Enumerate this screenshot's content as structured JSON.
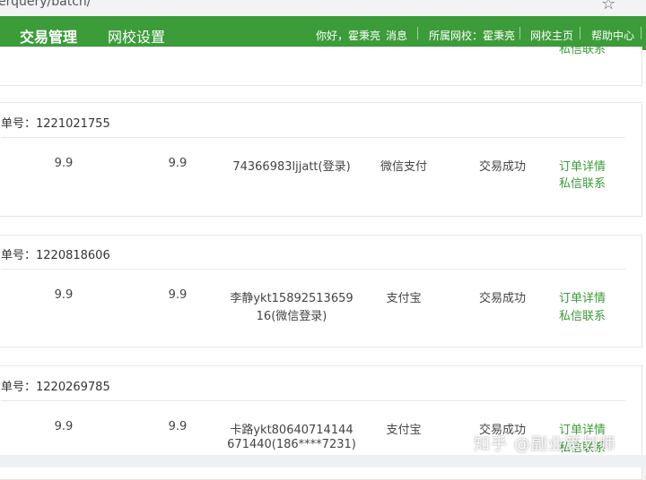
{
  "browser": {
    "url": "erquery/batch/"
  },
  "nav": {
    "tabs": [
      "交易管理",
      "网校设置"
    ],
    "greeting": "你好，霍秉亮",
    "messages": "消息",
    "school": "所属网校：霍秉亮",
    "home": "网校主页",
    "help": "帮助中心"
  },
  "top_partial_link": "私信联系",
  "orders": [
    {
      "order_no": "单号：1221021755",
      "price": "9.9",
      "paid": "9.9",
      "buyer_line1": "74366983ljjatt(登录)",
      "buyer_line2": "",
      "payment": "微信支付",
      "status": "交易成功",
      "detail_link": "订单详情",
      "contact_link": "私信联系"
    },
    {
      "order_no": "单号：1220818606",
      "price": "9.9",
      "paid": "9.9",
      "buyer_line1": "李静ykt15892513659",
      "buyer_line2": "16(微信登录)",
      "payment": "支付宝",
      "status": "交易成功",
      "detail_link": "订单详情",
      "contact_link": "私信联系"
    },
    {
      "order_no": "单号：1220269785",
      "price": "9.9",
      "paid": "9.9",
      "buyer_line1": "卡路ykt80640714144",
      "buyer_line2": "671440(186****7231)",
      "payment": "支付宝",
      "status": "交易成功",
      "detail_link": "订单详情",
      "contact_link": "私信联系"
    }
  ],
  "watermark": "知乎 @副业策划师"
}
